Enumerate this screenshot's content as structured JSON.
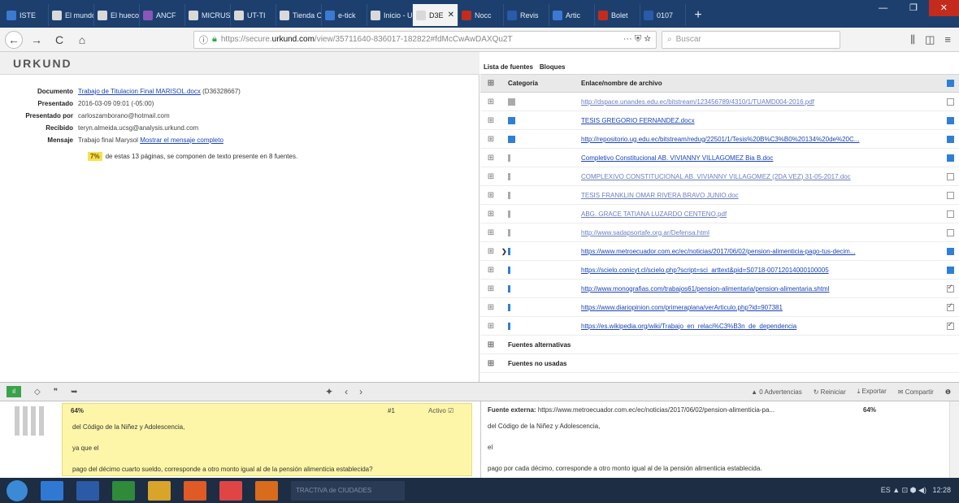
{
  "browser": {
    "tabs": [
      {
        "label": "ISTE",
        "color": "#3a7ad0"
      },
      {
        "label": "El mundo",
        "color": "#d9d9d9"
      },
      {
        "label": "El hueco",
        "color": "#d9d9d9"
      },
      {
        "label": "ANCF",
        "color": "#8a56b8"
      },
      {
        "label": "MICRUS",
        "color": "#d9d9d9"
      },
      {
        "label": "UT-TI",
        "color": "#d9d9d9"
      },
      {
        "label": "Tienda O",
        "color": "#d9d9d9"
      },
      {
        "label": "e-tick",
        "color": "#3a7ad0"
      },
      {
        "label": "Inicio - U",
        "color": "#d9d9d9"
      },
      {
        "label": "D3E",
        "color": "#d9d9d9"
      },
      {
        "label": "Nocc",
        "color": "#c42b1c"
      },
      {
        "label": "Revis",
        "color": "#2a5aa8"
      },
      {
        "label": "Artic",
        "color": "#3a7ad0"
      },
      {
        "label": "Bolet",
        "color": "#c42b1c"
      },
      {
        "label": "0107",
        "color": "#2a5aa8"
      }
    ],
    "active_tab_close": "✕",
    "new_tab": "+",
    "window_controls": {
      "min": "—",
      "max": "❐",
      "close": "✕"
    },
    "url_prefix": "https://secure.",
    "url_domain": "urkund.com",
    "url_rest": "/view/35711640-836017-182822#fdMcCwAwDAXQu2T",
    "url_actions": "··· ⛨ ☆",
    "search_placeholder": "Buscar",
    "nav_icons": {
      "back": "←",
      "forward": "→",
      "reload": "C",
      "home": "⌂",
      "library": "⫼",
      "sidebar": "◫",
      "menu": "≡"
    }
  },
  "app": {
    "logo": "URKUND"
  },
  "document_info": {
    "documento_label": "Documento",
    "documento_value": "Trabajo de Titulacion Final MARISOL.docx",
    "documento_id": "(D36328667)",
    "presentado_label": "Presentado",
    "presentado_value": "2016-03-09 09:01 (-05:00)",
    "presentado_por_label": "Presentado por",
    "presentado_por_value": "carloszamborano@hotmail.com",
    "recibido_label": "Recibido",
    "recibido_value": "teryn.almeida.ucsg@analysis.urkund.com",
    "mensaje_label": "Mensaje",
    "mensaje_value": "Trabajo final Marysol",
    "mensaje_link": "Mostrar el mensaje completo",
    "summary_pct": "7%",
    "summary_text": "de estas 13 páginas, se componen de texto presente en 8 fuentes."
  },
  "sources": {
    "tab_list": "Lista de fuentes",
    "tab_blocks": "Bloques",
    "col_category": "Categoría",
    "col_link": "Enlace/nombre de archivo",
    "rows": [
      {
        "exp": "⊞",
        "icon": "grey",
        "text": "http://dspace.unandes.edu.ec/bitstream/123456789/4310/1/TUAMD004-2016.pdf",
        "chk": "off",
        "dim": true
      },
      {
        "exp": "⊞",
        "icon": "blue",
        "text": "TESIS GREGORIO FERNANDEZ.docx",
        "chk": "on",
        "dim": false
      },
      {
        "exp": "⊞",
        "icon": "blue",
        "text": "http://repositorio.ug.edu.ec/bitstream/redug/22501/1/Tesis%20B%C3%B0%20134%20de%20C...",
        "chk": "on",
        "dim": false
      },
      {
        "exp": "⊞",
        "icon": "grey-thin",
        "text": "Completivo Constitucional AB. VIVIANNY VILLAGOMEZ Bia B.doc",
        "chk": "on",
        "dim": false
      },
      {
        "exp": "⊞",
        "icon": "grey-thin",
        "text": "COMPLEXIVO CONSTITUCIONAL AB. VIVIANNY VILLAGOMEZ (2DA VEZ) 31-05-2017.doc",
        "chk": "off",
        "dim": true
      },
      {
        "exp": "⊞",
        "icon": "grey-thin",
        "text": "TESIS FRANKLIN OMAR RIVERA BRAVO JUNIO.doc",
        "chk": "off",
        "dim": true
      },
      {
        "exp": "⊞",
        "icon": "grey-thin",
        "text": "ABG. GRACE TATIANA LUZARDO CENTENO.pdf",
        "chk": "off",
        "dim": true
      },
      {
        "exp": "⊞",
        "icon": "grey-thin",
        "text": "http://www.sadapsortafe.org.ar/Defensa.html",
        "chk": "off",
        "dim": true
      },
      {
        "exp": "⊞",
        "arrow": "❯",
        "icon": "blue-thin",
        "text": "https://www.metroecuador.com.ec/ec/noticias/2017/06/02/pension-alimenticia-pago-tus-decim...",
        "chk": "on",
        "dim": false
      },
      {
        "exp": "⊞",
        "icon": "blue-thin",
        "text": "https://scielo.conicyt.cl/scielo.php?script=sci_arttext&pid=S0718-00712014000100005",
        "chk": "on",
        "dim": false
      },
      {
        "exp": "⊞",
        "icon": "blue-thin",
        "text": "http://www.monografias.com/trabajos61/pension-alimentaria/pension-alimentaria.shtml",
        "chk": "tick",
        "dim": false
      },
      {
        "exp": "⊞",
        "icon": "blue-thin",
        "text": "https://www.diariopinion.com/primeraplana/verArticulo.php?id=907381",
        "chk": "tick",
        "dim": false
      },
      {
        "exp": "⊞",
        "icon": "blue-thin",
        "text": "https://es.wikipedia.org/wiki/Trabajo_en_relaci%C3%B3n_de_dependencia",
        "chk": "tick",
        "dim": false
      }
    ],
    "group_alternatives": "Fuentes alternativas",
    "group_unused": "Fuentes no usadas",
    "group_exp": "⊞"
  },
  "toolbar": {
    "chart_label": "ıl",
    "icon_puzzle": "◇",
    "icon_quote": "❞",
    "icon_tag": "➥",
    "nav_up": "✦",
    "nav_prev": "‹",
    "nav_next": "›",
    "advertencias": "▲ 0 Advertencias",
    "reiniciar": "↻ Reiniciar",
    "exportar": "⤓ Exportar",
    "compartir": "✉ Compartir",
    "info": "❶"
  },
  "compare": {
    "left_pct": "64%",
    "left_num": "#1",
    "left_active": "Activo ☑",
    "left_lines": [
      "del Código de la Niñez y Adolescencia,",
      "ya que el",
      "pago del décimo cuarto sueldo, corresponde a otro monto igual al de la pensión alimenticia establecida?"
    ],
    "right_source_label": "Fuente externa:",
    "right_source_url": "https://www.metroecuador.com.ec/ec/noticias/2017/06/02/pension-alimenticia-pa...",
    "right_pct": "64%",
    "right_lines": [
      "del Código de la Niñez y Adolescencia,",
      "el",
      "pago por cada décimo, corresponde a otro monto igual al de la pensión alimenticia establecida."
    ]
  },
  "taskbar": {
    "apps": [
      {
        "color": "#2f79d3"
      },
      {
        "color": "#2b5ba6"
      },
      {
        "color": "#2f8a3a"
      },
      {
        "color": "#d9a42a"
      },
      {
        "color": "#e05a25"
      },
      {
        "color": "#e04545"
      },
      {
        "color": "#d96b1c"
      }
    ],
    "active_label": "TRACTIVA de CIUDADES",
    "tray": "ES  ▲  ⊡  ⬢  ◀)",
    "clock": "12:28"
  },
  "colors": {
    "accent": "#2f7fd6",
    "link": "#1a44b8",
    "highlight": "#fdf6a8",
    "taskbar": "#1c2d44"
  }
}
